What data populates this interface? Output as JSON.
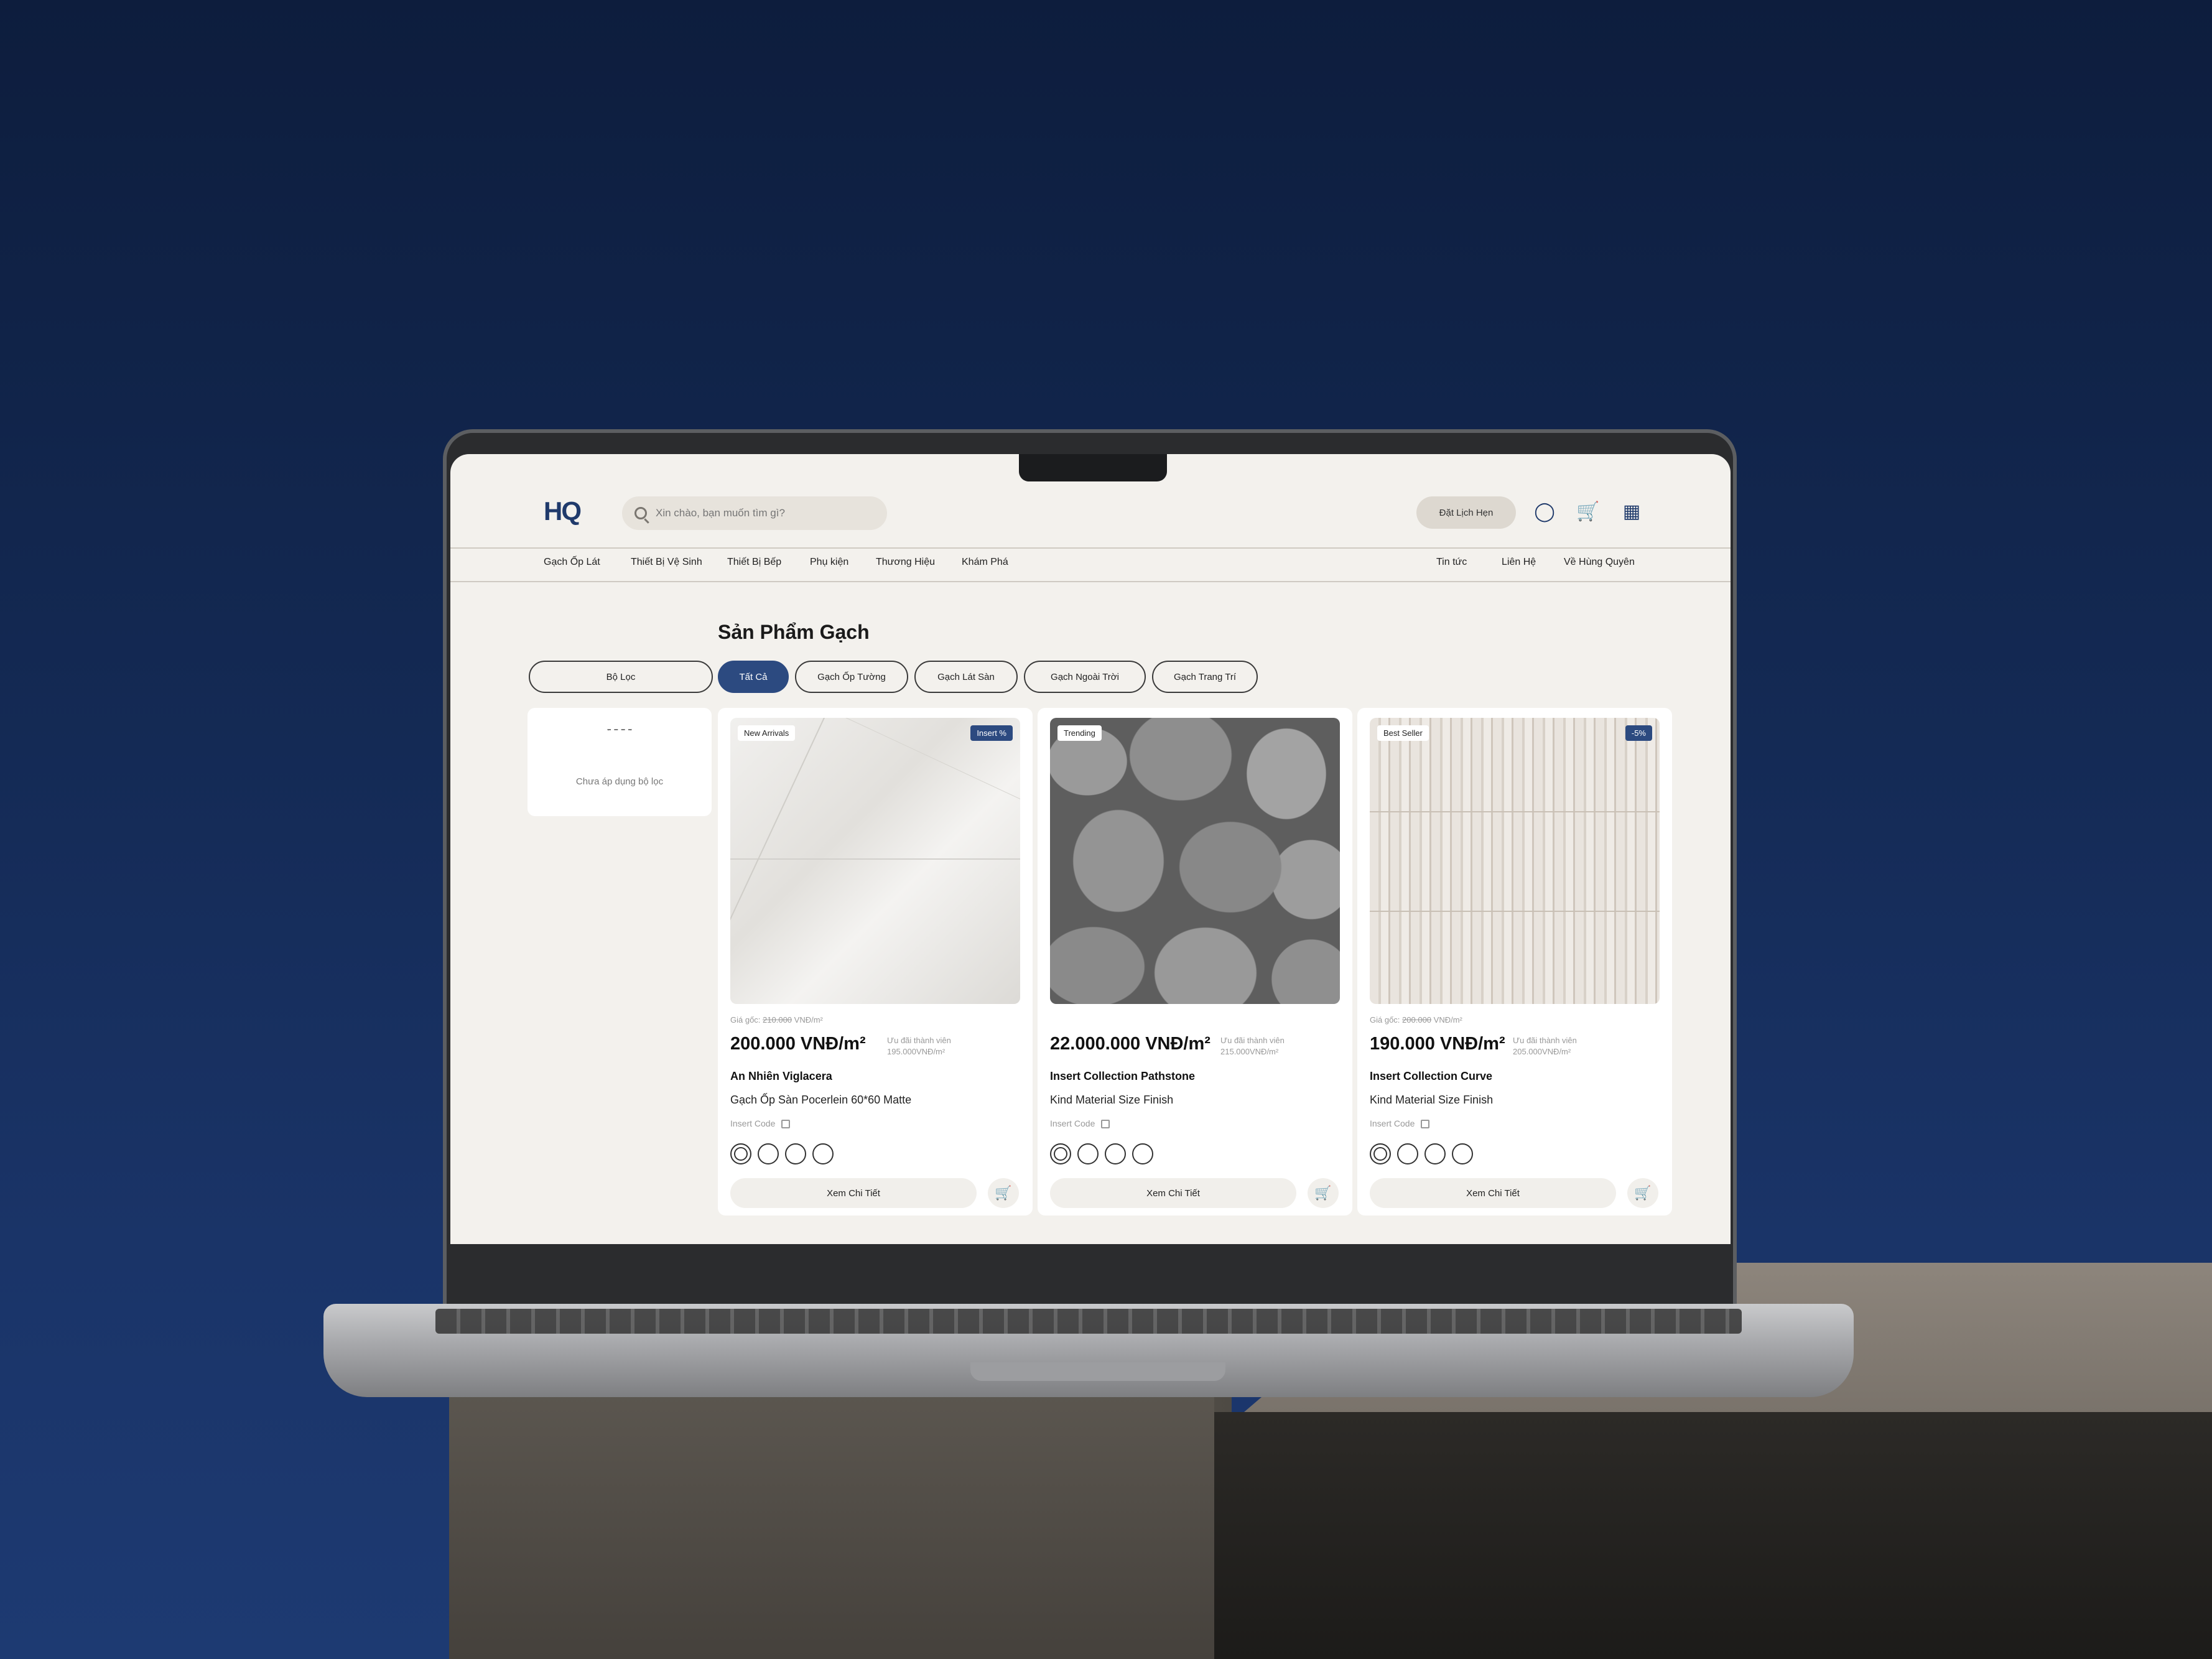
{
  "header": {
    "logo": "HQ",
    "search_placeholder": "Xin chào, bạn muốn tìm gì?",
    "book_label": "Đặt Lịch Hẹn",
    "icons": [
      "user-icon",
      "cart-icon",
      "apps-icon"
    ]
  },
  "nav": {
    "left": [
      "Gạch Ốp Lát",
      "Thiết Bị Vệ Sinh",
      "Thiết Bị Bếp",
      "Phụ kiện",
      "Thương Hiệu",
      "Khám Phá"
    ],
    "right": [
      "Tin tức",
      "Liên Hệ",
      "Về Hùng Quyên"
    ]
  },
  "page": {
    "title": "Sản Phẩm Gạch",
    "filter_label": "Bộ Lọc",
    "chips": [
      "Tất Cả",
      "Gạch Ốp Tường",
      "Gạch Lát Sàn",
      "Gạch Ngoài Trời",
      "Gạch Trang Trí"
    ],
    "empty_filter": "Chưa áp dụng bộ lọc"
  },
  "products": [
    {
      "tag": "New Arrivals",
      "tag_right": "Insert %",
      "orig_label": "Giá gốc:",
      "orig_price": "210.000",
      "orig_unit": "VNĐ/m²",
      "price": "200.000 VNĐ/m²",
      "member_label": "Ưu đãi thành viên",
      "member_price": "195.000VNĐ/m²",
      "name": "An Nhiên Viglacera",
      "subtitle": "Gạch Ốp Sàn Pocerlein 60*60 Matte",
      "code": "Insert Code",
      "detail": "Xem Chi Tiết"
    },
    {
      "tag": "Trending",
      "tag_right": "",
      "orig_label": "",
      "orig_price": "",
      "orig_unit": "",
      "price": "22.000.000 VNĐ/m²",
      "member_label": "Ưu đãi thành viên",
      "member_price": "215.000VNĐ/m²",
      "name": "Insert Collection Pathstone",
      "subtitle": "Kind Material Size Finish",
      "code": "Insert Code",
      "detail": "Xem Chi Tiết"
    },
    {
      "tag": "Best Seller",
      "tag_right": "-5%",
      "orig_label": "Giá gốc:",
      "orig_price": "200.000",
      "orig_unit": "VNĐ/m²",
      "price": "190.000 VNĐ/m²",
      "member_label": "Ưu đãi thành viên",
      "member_price": "205.000VNĐ/m²",
      "name": "Insert Collection Curve",
      "subtitle": "Kind Material Size Finish",
      "code": "Insert Code",
      "detail": "Xem Chi Tiết"
    }
  ]
}
